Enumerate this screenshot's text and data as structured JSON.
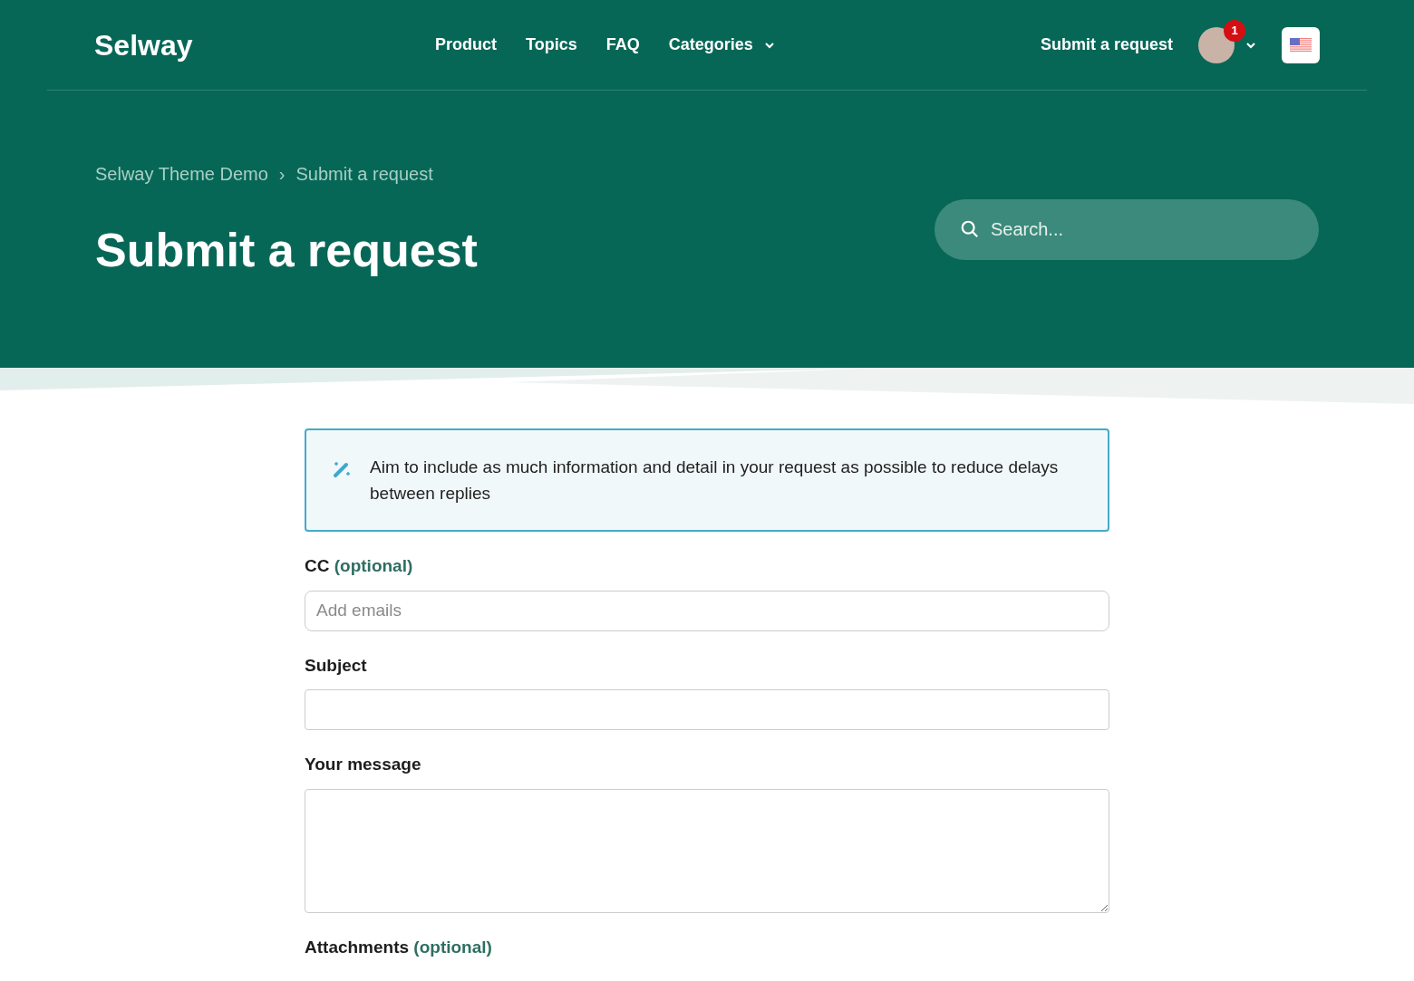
{
  "header": {
    "logo": "Selway",
    "nav": [
      {
        "label": "Product",
        "kind": "link"
      },
      {
        "label": "Topics",
        "kind": "link"
      },
      {
        "label": "FAQ",
        "kind": "link"
      },
      {
        "label": "Categories",
        "kind": "dropdown"
      }
    ],
    "submit_link": "Submit a request",
    "notification_count": "1"
  },
  "breadcrumbs": [
    "Selway Theme Demo",
    "Submit a request"
  ],
  "breadcrumb_separator": "›",
  "page_title": "Submit a request",
  "search": {
    "placeholder": "Search..."
  },
  "notice": "Aim to include as much information and detail in your request as possible to reduce delays between replies",
  "fields": [
    {
      "label": "CC",
      "optional": "(optional)",
      "kind": "input",
      "placeholder": "Add emails"
    },
    {
      "label": "Subject",
      "kind": "input"
    },
    {
      "label": "Your message",
      "kind": "textarea"
    },
    {
      "label": "Attachments",
      "optional": "(optional)",
      "kind": "label"
    }
  ]
}
